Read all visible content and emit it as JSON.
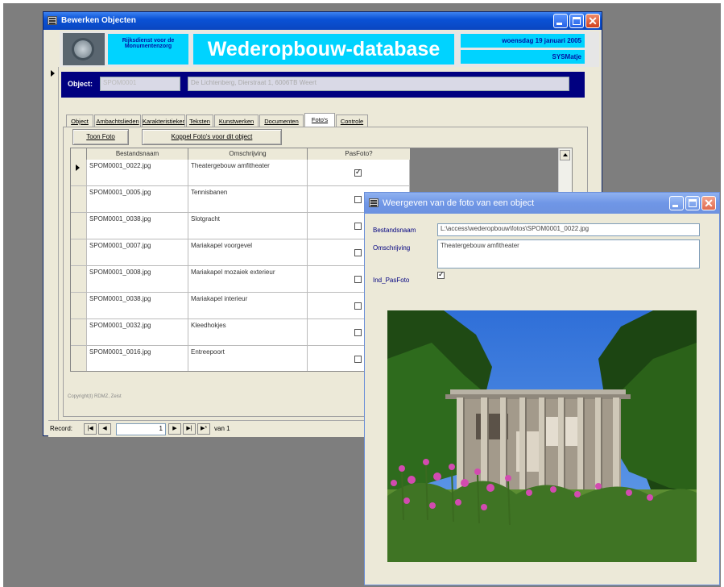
{
  "main_window": {
    "title": "Bewerken Objecten",
    "org_name": "Rijksdienst voor de Monumentenzorg",
    "banner_title": "Wederopbouw-database",
    "date": "woensdag 19 januari 2005",
    "user": "SYSMatje",
    "object_label": "Object:",
    "object_code": "SPOM0001",
    "object_address": "De Lichtenberg, Dierstraat 1, 6006TB Weert",
    "tabs": [
      "Object",
      "Ambachtslieden",
      "Karakteristieken",
      "Teksten",
      "Kunstwerken",
      "Documenten",
      "Foto's",
      "Controle"
    ],
    "active_tab": "Foto's",
    "toon_foto_button": "Toon Foto",
    "koppel_button": "Koppel Foto's voor dit object",
    "columns": [
      "Bestandsnaam",
      "Omschrijving",
      "PasFoto?"
    ],
    "rows": [
      {
        "file": "SPOM0001_0022.jpg",
        "desc": "Theatergebouw amfitheater",
        "pas": true
      },
      {
        "file": "SPOM0001_0005.jpg",
        "desc": "Tennisbanen",
        "pas": false
      },
      {
        "file": "SPOM0001_0038.jpg",
        "desc": "Slotgracht",
        "pas": false
      },
      {
        "file": "SPOM0001_0007.jpg",
        "desc": "Mariakapel voorgevel",
        "pas": false
      },
      {
        "file": "SPOM0001_0008.jpg",
        "desc": "Mariakapel mozaiek exterieur",
        "pas": false
      },
      {
        "file": "SPOM0001_0038.jpg",
        "desc": "Mariakapel interieur",
        "pas": false
      },
      {
        "file": "SPOM0001_0032.jpg",
        "desc": "Kleedhokjes",
        "pas": false
      },
      {
        "file": "SPOM0001_0016.jpg",
        "desc": "Entreepoort",
        "pas": false
      }
    ],
    "copyright": "Copyright(t) RDMZ, Zeist",
    "nav_record_label": "Record:",
    "nav_record_value": "1",
    "nav_of": "van 1"
  },
  "photo_window": {
    "title": "Weergeven van de foto van een object",
    "file_label": "Bestandsnaam",
    "file_value": "L:\\access\\wederopbouw\\fotos\\SPOM0001_0022.jpg",
    "desc_label": "Omschrijving",
    "desc_value": "Theatergebouw amfitheater",
    "pas_label": "Ind_PasFoto",
    "pas_checked": true
  },
  "colors": {
    "desktop": "#7e7e7e",
    "window_face": "#ece9d8",
    "banner": "#00d3ff",
    "object_bar": "#000080",
    "titlebar": "#0a52d6"
  },
  "icons": [
    "form-icon",
    "minimize-icon",
    "maximize-icon",
    "close-icon",
    "record-selector-icon",
    "nav-first-icon",
    "nav-prev-icon",
    "nav-next-icon",
    "nav-last-icon",
    "nav-new-icon",
    "scroll-up-icon",
    "logo-emblem-icon"
  ]
}
